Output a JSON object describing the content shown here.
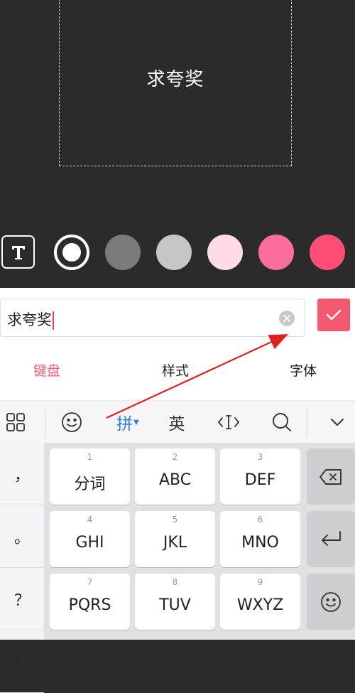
{
  "canvas": {
    "text": "求夸奖"
  },
  "colors": {
    "palette": [
      "#ffffff",
      "#7a7a7c",
      "#c6c6c8",
      "#ffdbe8",
      "#fb6d9d",
      "#ff4d78"
    ],
    "accent": "#f05c72",
    "annotation": "#e02020"
  },
  "input": {
    "value": "求夸奖"
  },
  "tabs": [
    {
      "label": "键盘",
      "active": true
    },
    {
      "label": "样式",
      "active": false
    },
    {
      "label": "字体",
      "active": false
    }
  ],
  "toolbar": {
    "items": [
      "grid-icon",
      "emoji-icon",
      "拼",
      "英",
      "cursor-icon",
      "search-icon",
      "chevron-down-icon"
    ]
  },
  "keyboard": {
    "punctuation": [
      "，",
      "。",
      "？",
      "！"
    ],
    "keys": [
      {
        "num": "1",
        "label": "分词"
      },
      {
        "num": "2",
        "label": "ABC"
      },
      {
        "num": "3",
        "label": "DEF"
      },
      {
        "num": "4",
        "label": "GHI"
      },
      {
        "num": "5",
        "label": "JKL"
      },
      {
        "num": "6",
        "label": "MNO"
      },
      {
        "num": "7",
        "label": "PQRS"
      },
      {
        "num": "8",
        "label": "TUV"
      },
      {
        "num": "9",
        "label": "WXYZ"
      }
    ],
    "function_keys": [
      "backspace-icon",
      "enter-icon",
      "emoji-icon"
    ]
  }
}
